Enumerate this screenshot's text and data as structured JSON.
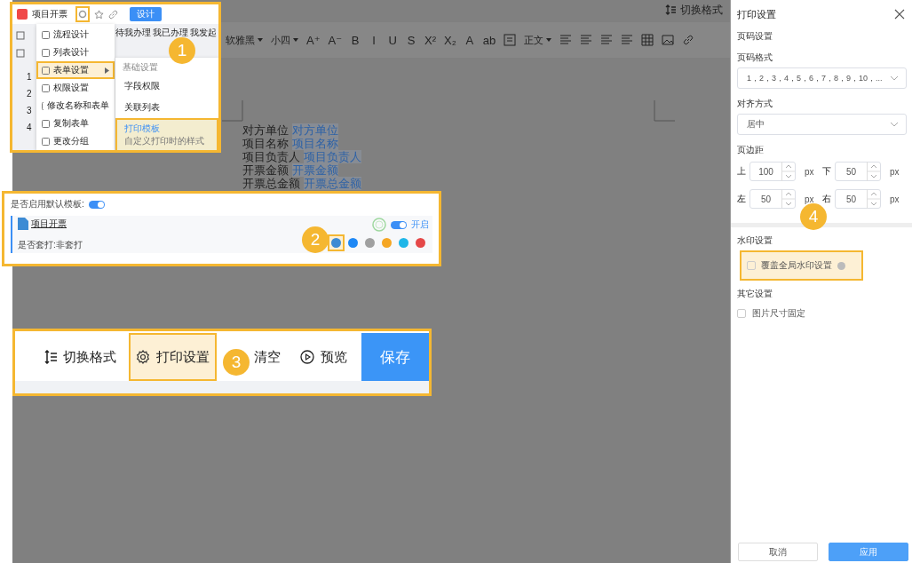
{
  "editor": {
    "switch_format": "切换格式",
    "toolbar": {
      "font": "软雅黑",
      "size": "小四",
      "paragraph": "正文",
      "format_buttons": [
        "A⁺",
        "A⁻",
        "B",
        "I",
        "U",
        "S",
        "X²",
        "X₂",
        "A",
        "ab"
      ]
    },
    "fields": [
      {
        "label": "对方单位",
        "value": "对方单位"
      },
      {
        "label": "项目名称",
        "value": "项目名称"
      },
      {
        "label": "项目负责人",
        "value": "项目负责人"
      },
      {
        "label": "开票金额",
        "value": "开票金额"
      },
      {
        "label": "开票总金额",
        "value": "开票总金额"
      }
    ]
  },
  "step_form_menu": {
    "callout": "1",
    "app_name": "项目开票",
    "settings_highlighted": true,
    "design_button": "设计",
    "tabs": [
      "待我办理",
      "我已办理",
      "我发起"
    ],
    "row_numbers": [
      "1",
      "2",
      "3",
      "4"
    ],
    "menu": [
      {
        "label": "流程设计",
        "highlighted": false,
        "has_submenu": false
      },
      {
        "label": "列表设计",
        "highlighted": false,
        "has_submenu": false
      },
      {
        "label": "表单设置",
        "highlighted": true,
        "has_submenu": true
      },
      {
        "label": "权限设置",
        "highlighted": false,
        "has_submenu": false
      },
      {
        "label": "修改名称和表单",
        "highlighted": false,
        "has_submenu": false
      },
      {
        "label": "复制表单",
        "highlighted": false,
        "has_submenu": false
      },
      {
        "label": "更改分组",
        "highlighted": false,
        "has_submenu": false
      }
    ],
    "submenu_header": "基础设置",
    "submenu": [
      {
        "title": "字段权限",
        "highlighted": false
      },
      {
        "title": "关联列表",
        "highlighted": false
      },
      {
        "title": "打印模板",
        "description": "自定义打印时的样式",
        "highlighted": true
      }
    ]
  },
  "step_template": {
    "callout": "2",
    "default_label": "是否启用默认模板:",
    "default_on": true,
    "template": {
      "name": "项目开票",
      "print_mode": "是否套打:非套打",
      "enabled": true,
      "enabled_label": "开启"
    },
    "actions": [
      {
        "color": "#3d8bd4",
        "highlighted": true
      },
      {
        "color": "#1e88f5",
        "highlighted": false
      },
      {
        "color": "#a0a0a0",
        "highlighted": false
      },
      {
        "color": "#f5a623",
        "highlighted": false
      },
      {
        "color": "#1fb6e8",
        "highlighted": false
      },
      {
        "color": "#e54848",
        "highlighted": false
      }
    ]
  },
  "step_toolbar": {
    "callout": "3",
    "items": [
      {
        "kind": "format",
        "label": "切换格式",
        "highlighted": false
      },
      {
        "kind": "settings",
        "label": "打印设置",
        "highlighted": true
      },
      {
        "kind": "clear",
        "label": "清空",
        "highlighted": false
      },
      {
        "kind": "preview",
        "label": "预览",
        "highlighted": false
      }
    ],
    "save": "保存"
  },
  "print_panel": {
    "title": "打印设置",
    "page_section": "页码设置",
    "format_label": "页码格式",
    "format_value": "1，2，3，4，5，6，7，8，9，10，...",
    "align_label": "对齐方式",
    "align_value": "居中",
    "margin_label": "页边距",
    "margins": [
      {
        "label": "上",
        "value": "100",
        "unit": "px"
      },
      {
        "label": "下",
        "value": "50",
        "unit": "px"
      },
      {
        "label": "左",
        "value": "50",
        "unit": "px"
      },
      {
        "label": "右",
        "value": "50",
        "unit": "px"
      }
    ],
    "callout": "4",
    "watermark_section": "水印设置",
    "watermark_override": {
      "label": "覆盖全局水印设置",
      "checked": false,
      "highlighted": true
    },
    "other_section": "其它设置",
    "fixed_image_size": {
      "label": "图片尺寸固定",
      "checked": false
    },
    "buttons": [
      "取消",
      "应用"
    ]
  }
}
